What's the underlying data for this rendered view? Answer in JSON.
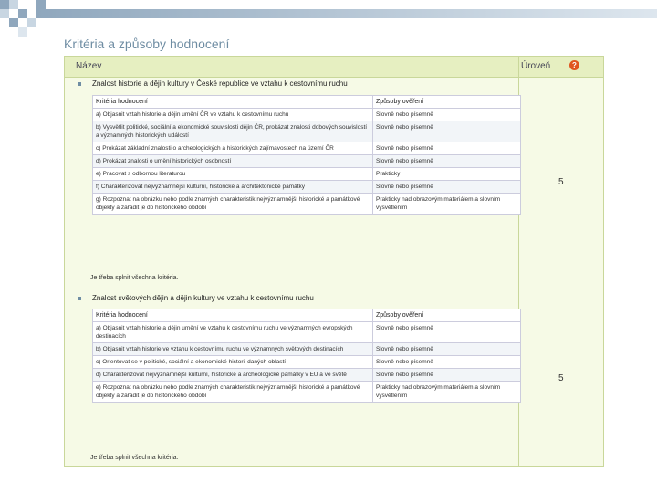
{
  "page_title": "Kritéria a způsoby hodnocení",
  "table_header": {
    "name_col": "Název",
    "level_col": "Úroveň",
    "help_icon": "question-icon"
  },
  "sections": [
    {
      "title": "Znalost historie a dějin kultury v České republice ve vztahu k cestovnímu ruchu",
      "criteria_header": "Kritéria hodnocení",
      "methods_header": "Způsoby ověření",
      "rows": [
        {
          "criterion": "a) Objasnit vztah historie a dějin umění ČR ve vztahu k cestovnímu ruchu",
          "method": "Slovně nebo písemně"
        },
        {
          "criterion": "b) Vysvětlit politické, sociální a ekonomické souvislosti dějin ČR, prokázat znalosti dobových souvislostí a významných historických událostí",
          "method": "Slovně nebo písemně"
        },
        {
          "criterion": "c) Prokázat základní znalosti o archeologických a historických zajímavostech na území ČR",
          "method": "Slovně nebo písemně"
        },
        {
          "criterion": "d) Prokázat znalosti o umění historických osobností",
          "method": "Slovně nebo písemně"
        },
        {
          "criterion": "e) Pracovat s odbornou literaturou",
          "method": "Prakticky"
        },
        {
          "criterion": "f) Charakterizovat nejvýznamnější kulturní, historické a architektonické památky",
          "method": "Slovně nebo písemně"
        },
        {
          "criterion": "g) Rozpoznat na obrázku nebo podle známých charakteristik nejvýznamnější historické a památkové objekty a zařadit je do historického období",
          "method": "Prakticky nad obrazovým materiálem a slovním vysvětlením"
        }
      ],
      "note": "Je třeba splnit všechna kritéria.",
      "level": "5"
    },
    {
      "title": "Znalost světových dějin a dějin kultury ve vztahu k cestovnímu ruchu",
      "criteria_header": "Kritéria hodnocení",
      "methods_header": "Způsoby ověření",
      "rows": [
        {
          "criterion": "a) Objasnit vztah historie a dějin umění ve vztahu k cestovnímu ruchu ve významných evropských destinacích",
          "method": "Slovně nebo písemně"
        },
        {
          "criterion": "b) Objasnit vztah historie ve vztahu k cestovnímu ruchu ve významných světových destinacích",
          "method": "Slovně nebo písemně"
        },
        {
          "criterion": "c) Orientovat se v politické, sociální a ekonomické historii daných oblastí",
          "method": "Slovně nebo písemně"
        },
        {
          "criterion": "d) Charakterizovat nejvýznamnější kulturní, historické a archeologické památky v EU a ve světě",
          "method": "Slovně nebo písemně"
        },
        {
          "criterion": "e) Rozpoznat na obrázku nebo podle známých charakteristik nejvýznamnější historické a památkové objekty a zařadit je do historického období",
          "method": "Prakticky nad obrazovým materiálem a slovním vysvětlením"
        }
      ],
      "note": "Je třeba splnit všechna kritéria.",
      "level": "5"
    }
  ],
  "colors": {
    "accent": "#6f8da3",
    "header_bg": "#e6efc1",
    "panel_bg": "#f6fae6",
    "border": "#c9d79a"
  }
}
